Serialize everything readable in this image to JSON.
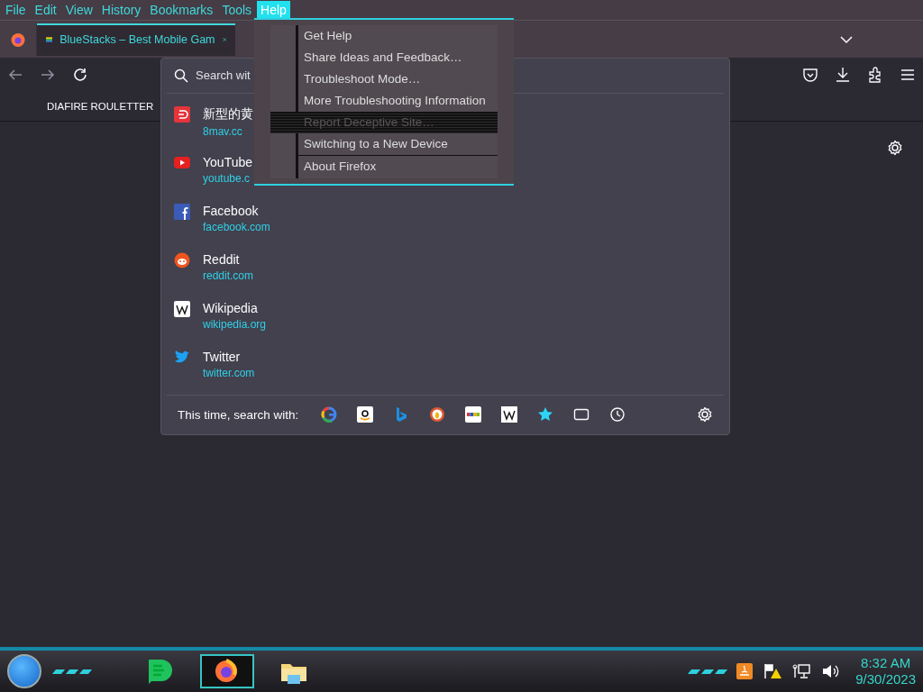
{
  "menu_bar": [
    {
      "label": "File",
      "selected": false
    },
    {
      "label": "Edit",
      "selected": false
    },
    {
      "label": "View",
      "selected": false
    },
    {
      "label": "History",
      "selected": false
    },
    {
      "label": "Bookmarks",
      "selected": false
    },
    {
      "label": "Tools",
      "selected": false
    },
    {
      "label": "Help",
      "selected": true
    }
  ],
  "tabs": [
    {
      "title": "BlueStacks – Best Mobile Gam",
      "selected": true
    }
  ],
  "bookmarks": [
    "DIAFIRE ROULETTER"
  ],
  "search_dropdown": {
    "placeholder": "Search wit",
    "sites": [
      {
        "name": "新型的黄",
        "url": "8mav.cc"
      },
      {
        "name": "YouTube",
        "url": "youtube.c"
      },
      {
        "name": "Facebook",
        "url": "facebook.com"
      },
      {
        "name": "Reddit",
        "url": "reddit.com"
      },
      {
        "name": "Wikipedia",
        "url": "wikipedia.org"
      },
      {
        "name": "Twitter",
        "url": "twitter.com"
      }
    ],
    "search_with_label": "This time, search with:"
  },
  "help_menu": [
    {
      "label": "Get Help",
      "disabled": false
    },
    {
      "label": "Share Ideas and Feedback…",
      "disabled": false
    },
    {
      "label": "Troubleshoot Mode…",
      "disabled": false
    },
    {
      "label": "More Troubleshooting Information",
      "disabled": false
    },
    {
      "label": "Report Deceptive Site…",
      "disabled": true
    },
    {
      "label": "Switching to a New Device",
      "disabled": false
    },
    {
      "label": "About Firefox",
      "disabled": false
    }
  ],
  "taskbar": {
    "apps": [
      {
        "active": false
      },
      {
        "active": true
      },
      {
        "active": false
      }
    ],
    "time": "8:32 AM",
    "date": "9/30/2023"
  }
}
